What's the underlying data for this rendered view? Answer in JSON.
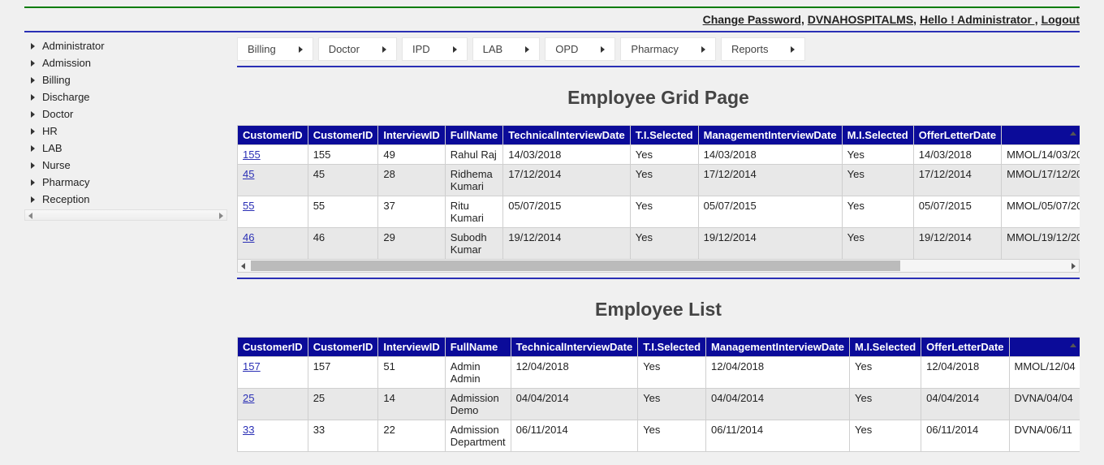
{
  "header": {
    "change_password": "Change Password,",
    "site_name": "DVNAHOSPITALMS,",
    "greeting": "Hello ! Administrator ,",
    "logout": "Logout"
  },
  "sidebar": {
    "items": [
      "Administrator",
      "Admission",
      "Billing",
      "Discharge",
      "Doctor",
      "HR",
      "LAB",
      "Nurse",
      "Pharmacy",
      "Reception"
    ]
  },
  "menubar": {
    "items": [
      "Billing",
      "Doctor",
      "IPD",
      "LAB",
      "OPD",
      "Pharmacy",
      "Reports"
    ]
  },
  "section1": {
    "title": "Employee Grid Page",
    "columns": [
      "CustomerID",
      "CustomerID",
      "InterviewID",
      "FullName",
      "TechnicalInterviewDate",
      "T.I.Selected",
      "ManagementInterviewDate",
      "M.I.Selected",
      "OfferLetterDate",
      ""
    ],
    "rows": [
      {
        "link": "155",
        "custid": "155",
        "intid": "49",
        "name": "Rahul Raj",
        "tdate": "14/03/2018",
        "tsel": "Yes",
        "mdate": "14/03/2018",
        "msel": "Yes",
        "offer": "14/03/2018",
        "extra": "MMOL/14/03/20"
      },
      {
        "link": "45",
        "custid": "45",
        "intid": "28",
        "name": "Ridhema Kumari",
        "tdate": "17/12/2014",
        "tsel": "Yes",
        "mdate": "17/12/2014",
        "msel": "Yes",
        "offer": "17/12/2014",
        "extra": "MMOL/17/12/20"
      },
      {
        "link": "55",
        "custid": "55",
        "intid": "37",
        "name": "Ritu Kumari",
        "tdate": "05/07/2015",
        "tsel": "Yes",
        "mdate": "05/07/2015",
        "msel": "Yes",
        "offer": "05/07/2015",
        "extra": "MMOL/05/07/20"
      },
      {
        "link": "46",
        "custid": "46",
        "intid": "29",
        "name": "Subodh Kumar",
        "tdate": "19/12/2014",
        "tsel": "Yes",
        "mdate": "19/12/2014",
        "msel": "Yes",
        "offer": "19/12/2014",
        "extra": "MMOL/19/12/20"
      }
    ]
  },
  "section2": {
    "title": "Employee List",
    "columns": [
      "CustomerID",
      "CustomerID",
      "InterviewID",
      "FullName",
      "TechnicalInterviewDate",
      "T.I.Selected",
      "ManagementInterviewDate",
      "M.I.Selected",
      "OfferLetterDate",
      ""
    ],
    "rows": [
      {
        "link": "157",
        "custid": "157",
        "intid": "51",
        "name": "Admin Admin",
        "tdate": "12/04/2018",
        "tsel": "Yes",
        "mdate": "12/04/2018",
        "msel": "Yes",
        "offer": "12/04/2018",
        "extra": "MMOL/12/04"
      },
      {
        "link": "25",
        "custid": "25",
        "intid": "14",
        "name": "Admission Demo",
        "tdate": "04/04/2014",
        "tsel": "Yes",
        "mdate": "04/04/2014",
        "msel": "Yes",
        "offer": "04/04/2014",
        "extra": "DVNA/04/04"
      },
      {
        "link": "33",
        "custid": "33",
        "intid": "22",
        "name": "Admission Department",
        "tdate": "06/11/2014",
        "tsel": "Yes",
        "mdate": "06/11/2014",
        "msel": "Yes",
        "offer": "06/11/2014",
        "extra": "DVNA/06/11"
      }
    ]
  }
}
